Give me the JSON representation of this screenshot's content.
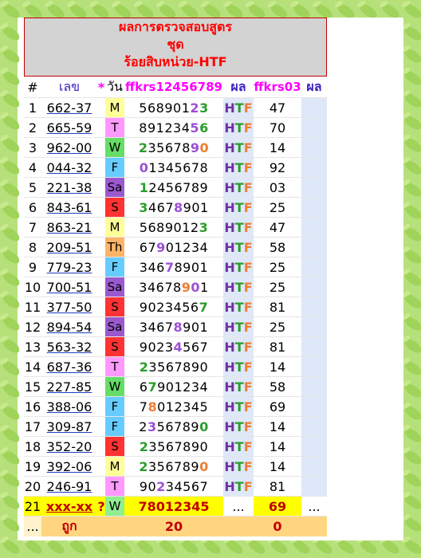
{
  "header": {
    "line1": "ผลการตรวจสอบสูตร",
    "line2": "ชุด",
    "line3": "ร้อยสิบหน่วย-HTF"
  },
  "columns": {
    "hash": "#",
    "number": "เลข",
    "star": "*",
    "day": "วัน",
    "formula1": "ffkrs12456789",
    "result1": "ผล",
    "formula2": "ffkrs03",
    "result2": "ผล"
  },
  "day_colors": {
    "M": "#ffff99",
    "T": "#ff99ff",
    "W": "#66dd66",
    "F": "#66ccff",
    "Sa": "#9b59d0",
    "S": "#ff3333",
    "Th": "#ffb366"
  },
  "digit_colors": {
    "g": "#2a9d2a",
    "o": "#ed7d31",
    "p": "#9b4fd6"
  },
  "rows": [
    {
      "n": "1",
      "num": "662-37",
      "day": "M",
      "digits": "56890123",
      "marks": "nnnnnnpg",
      "htf": "HTF",
      "f2": "47"
    },
    {
      "n": "2",
      "num": "665-59",
      "day": "T",
      "digits": "89123456",
      "marks": "nnnnnnpg",
      "htf": "HTF",
      "f2": "70"
    },
    {
      "n": "3",
      "num": "962-00",
      "day": "W",
      "digits": "23567890",
      "marks": "gnnnnnpo",
      "htf": "HTF",
      "f2": "14"
    },
    {
      "n": "4",
      "num": "044-32",
      "day": "F",
      "digits": "01345678",
      "marks": "pnnnnnnn",
      "htf": "HTF",
      "f2": "92"
    },
    {
      "n": "5",
      "num": "221-38",
      "day": "Sa",
      "digits": "12456789",
      "marks": "gnnnnnnn",
      "htf": "HTF",
      "f2": "03"
    },
    {
      "n": "6",
      "num": "843-61",
      "day": "S",
      "digits": "34678901",
      "marks": "gnnnpnnn",
      "htf": "HTF",
      "f2": "25"
    },
    {
      "n": "7",
      "num": "863-21",
      "day": "M",
      "digits": "56890123",
      "marks": "nnnnnnng",
      "htf": "HTF",
      "f2": "47"
    },
    {
      "n": "8",
      "num": "209-51",
      "day": "Th",
      "digits": "67901234",
      "marks": "nnpnnnnn",
      "htf": "HTF",
      "f2": "58"
    },
    {
      "n": "9",
      "num": "779-23",
      "day": "F",
      "digits": "34678901",
      "marks": "nnnpnnnn",
      "htf": "HTF",
      "f2": "25"
    },
    {
      "n": "10",
      "num": "700-51",
      "day": "Sa",
      "digits": "34678901",
      "marks": "nnnnnopn",
      "htf": "HTF",
      "f2": "25"
    },
    {
      "n": "11",
      "num": "377-50",
      "day": "S",
      "digits": "90234567",
      "marks": "nnnnnnng",
      "htf": "HTF",
      "f2": "81"
    },
    {
      "n": "12",
      "num": "894-54",
      "day": "Sa",
      "digits": "34678901",
      "marks": "nnnnpnnn",
      "htf": "HTF",
      "f2": "25"
    },
    {
      "n": "13",
      "num": "563-32",
      "day": "S",
      "digits": "90234567",
      "marks": "nnnnpnnn",
      "htf": "HTF",
      "f2": "81"
    },
    {
      "n": "14",
      "num": "687-36",
      "day": "T",
      "digits": "23567890",
      "marks": "gnnnnnnn",
      "htf": "HTF",
      "f2": "14"
    },
    {
      "n": "15",
      "num": "227-85",
      "day": "W",
      "digits": "67901234",
      "marks": "ngnnnnnn",
      "htf": "HTF",
      "f2": "58"
    },
    {
      "n": "16",
      "num": "388-06",
      "day": "F",
      "digits": "78012345",
      "marks": "nonnnnnn",
      "htf": "HTF",
      "f2": "69"
    },
    {
      "n": "17",
      "num": "309-87",
      "day": "F",
      "digits": "23567890",
      "marks": "npnnnnng",
      "htf": "HTF",
      "f2": "14"
    },
    {
      "n": "18",
      "num": "352-20",
      "day": "S",
      "digits": "23567890",
      "marks": "gnnnnnnn",
      "htf": "HTF",
      "f2": "14"
    },
    {
      "n": "19",
      "num": "392-06",
      "day": "M",
      "digits": "23567890",
      "marks": "gnnnnnno",
      "htf": "HTF",
      "f2": "14"
    },
    {
      "n": "20",
      "num": "246-91",
      "day": "T",
      "digits": "90234567",
      "marks": "nnpnnnnn",
      "htf": "HTF",
      "f2": "81"
    }
  ],
  "prediction": {
    "n": "21",
    "num": "xxx-xx",
    "star": "?",
    "day": "W",
    "digits": "78012345",
    "result1": "...",
    "f2": "69",
    "result2": "..."
  },
  "totals": {
    "dots": "...",
    "label": "ถูก",
    "formula1": "20",
    "formula2": "0"
  }
}
